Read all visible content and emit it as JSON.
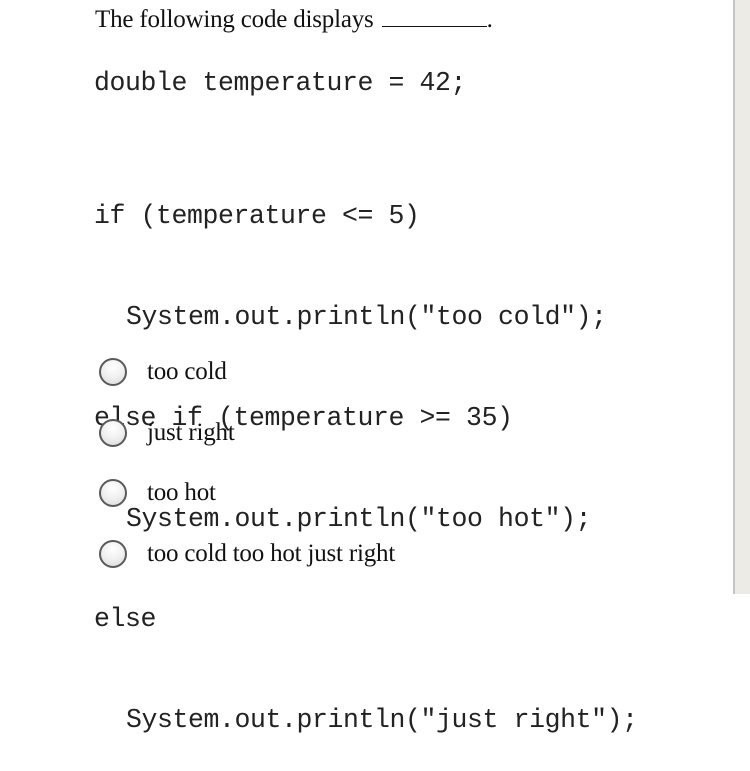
{
  "question": {
    "text": "The following code displays",
    "end_punct": "."
  },
  "code": {
    "declaration": "double temperature = 42;",
    "lines": [
      {
        "text": "if (temperature <= 5)",
        "indent": false
      },
      {
        "text": "System.out.println(\"too cold\");",
        "indent": true
      },
      {
        "text": "else if (temperature >= 35)",
        "indent": false
      },
      {
        "text": "System.out.println(\"too hot\");",
        "indent": true
      },
      {
        "text": "else",
        "indent": false
      },
      {
        "text": "System.out.println(\"just right\");",
        "indent": true
      }
    ]
  },
  "options": [
    {
      "label": "too cold",
      "selected": false
    },
    {
      "label": "just right",
      "selected": false
    },
    {
      "label": "too hot",
      "selected": false
    },
    {
      "label": "too cold too hot just right",
      "selected": false
    }
  ]
}
